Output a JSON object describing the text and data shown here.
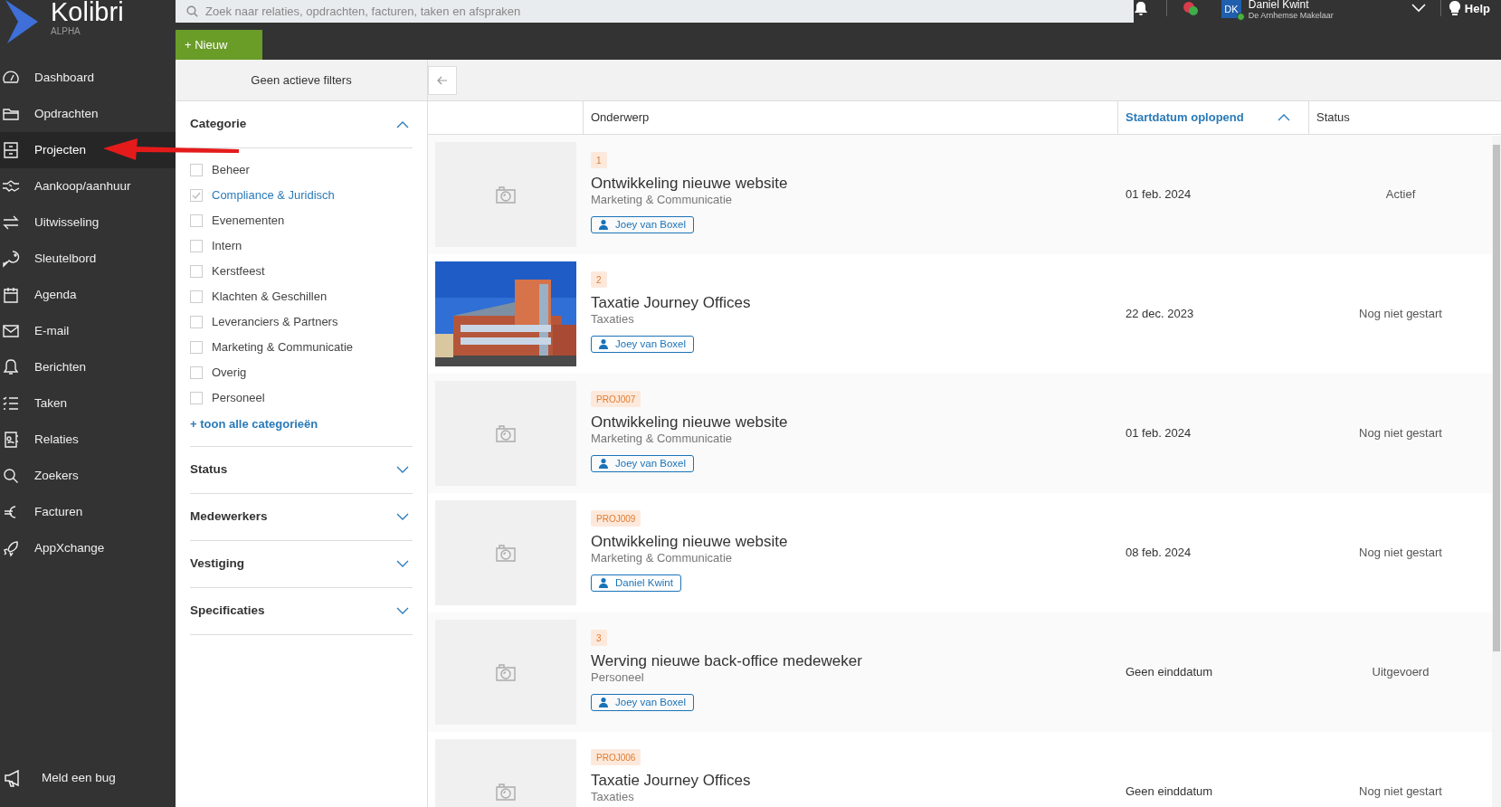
{
  "app": {
    "name": "Kolibri",
    "edition": "ALPHA"
  },
  "search": {
    "placeholder": "Zoek naar relaties, opdrachten, facturen, taken en afspraken"
  },
  "user": {
    "initials": "DK",
    "name": "Daniel Kwint",
    "company": "De Arnhemse Makelaar"
  },
  "help": "Help",
  "new_button": "+ Nieuw",
  "sidebar": {
    "items": [
      {
        "label": "Dashboard",
        "selected": false
      },
      {
        "label": "Opdrachten",
        "selected": false
      },
      {
        "label": "Projecten",
        "selected": true
      },
      {
        "label": "Aankoop/aanhuur",
        "selected": false
      },
      {
        "label": "Uitwisseling",
        "selected": false
      },
      {
        "label": "Sleutelbord",
        "selected": false
      },
      {
        "label": "Agenda",
        "selected": false
      },
      {
        "label": "E-mail",
        "selected": false
      },
      {
        "label": "Berichten",
        "selected": false
      },
      {
        "label": "Taken",
        "selected": false
      },
      {
        "label": "Relaties",
        "selected": false
      },
      {
        "label": "Zoekers",
        "selected": false
      },
      {
        "label": "Facturen",
        "selected": false
      },
      {
        "label": "AppXchange",
        "selected": false
      }
    ],
    "footer": "Meld een bug"
  },
  "filters": {
    "summary": "Geen actieve filters",
    "sections": [
      {
        "title": "Categorie",
        "expanded": true,
        "options": [
          {
            "label": "Beheer",
            "checked": false
          },
          {
            "label": "Compliance & Juridisch",
            "checked": true
          },
          {
            "label": "Evenementen",
            "checked": false
          },
          {
            "label": "Intern",
            "checked": false
          },
          {
            "label": "Kerstfeest",
            "checked": false
          },
          {
            "label": "Klachten & Geschillen",
            "checked": false
          },
          {
            "label": "Leveranciers & Partners",
            "checked": false
          },
          {
            "label": "Marketing & Communicatie",
            "checked": false
          },
          {
            "label": "Overig",
            "checked": false
          },
          {
            "label": "Personeel",
            "checked": false
          }
        ],
        "more": "+ toon alle categorieën"
      },
      {
        "title": "Status",
        "expanded": false
      },
      {
        "title": "Medewerkers",
        "expanded": false
      },
      {
        "title": "Vestiging",
        "expanded": false
      },
      {
        "title": "Specificaties",
        "expanded": false
      }
    ]
  },
  "table": {
    "columns": [
      {
        "label": "Onderwerp",
        "sorted": false
      },
      {
        "label": "Startdatum oplopend",
        "sorted": true
      },
      {
        "label": "Status",
        "sorted": false
      }
    ],
    "rows": [
      {
        "kind": "placeholder",
        "code": "1",
        "title": "Ontwikkeling nieuwe website",
        "category": "Marketing & Communicatie",
        "person": "Joey van Boxel",
        "date": "01 feb. 2024",
        "status": "Actief"
      },
      {
        "kind": "picture",
        "code": "2",
        "title": "Taxatie Journey Offices",
        "category": "Taxaties",
        "person": "Joey van Boxel",
        "date": "22 dec. 2023",
        "status": "Nog niet gestart"
      },
      {
        "kind": "placeholder",
        "code": "PROJ007",
        "title": "Ontwikkeling nieuwe website",
        "category": "Marketing & Communicatie",
        "person": "Joey van Boxel",
        "date": "01 feb. 2024",
        "status": "Nog niet gestart"
      },
      {
        "kind": "placeholder",
        "code": "PROJ009",
        "title": "Ontwikkeling nieuwe website",
        "category": "Marketing & Communicatie",
        "person": "Daniel Kwint",
        "date": "08 feb. 2024",
        "status": "Nog niet gestart"
      },
      {
        "kind": "placeholder",
        "code": "3",
        "title": "Werving nieuwe back-office medeweker",
        "category": "Personeel",
        "person": "Joey van Boxel",
        "date": "Geen einddatum",
        "status": "Uitgevoerd"
      },
      {
        "kind": "placeholder",
        "code": "PROJ006",
        "title": "Taxatie Journey Offices",
        "category": "Taxaties",
        "date": "Geen einddatum",
        "status": "Nog niet gestart"
      }
    ]
  }
}
